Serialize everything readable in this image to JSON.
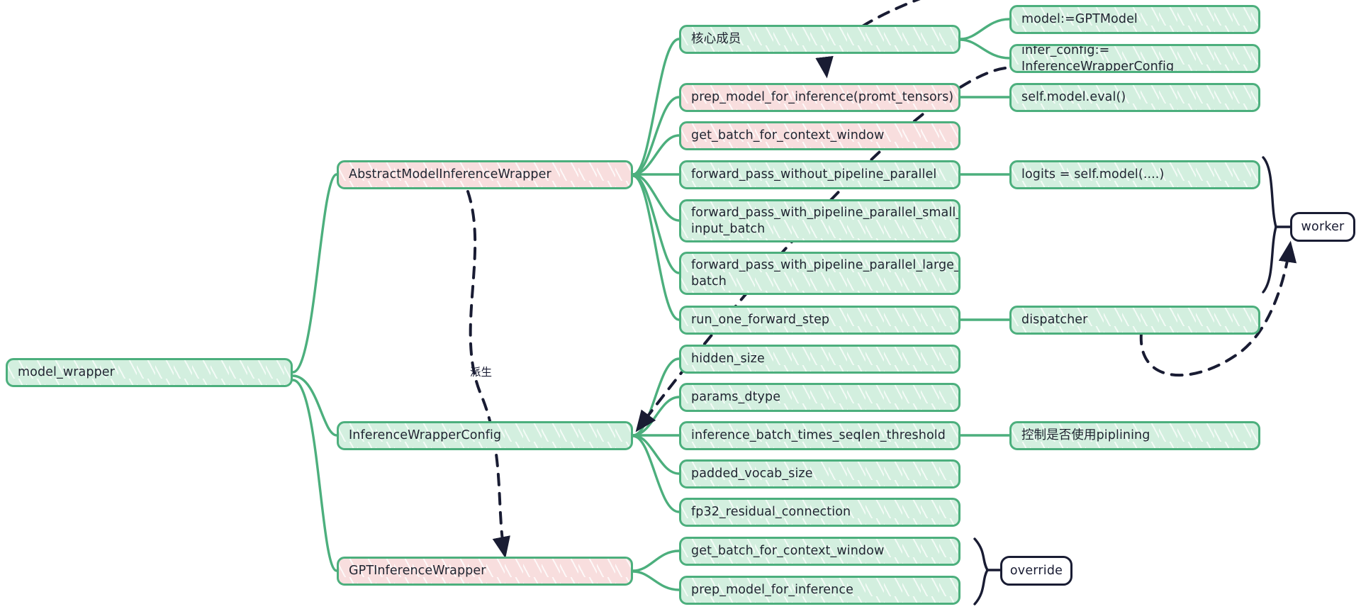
{
  "diagram": {
    "type": "mindmap",
    "title": "model_wrapper",
    "colors": {
      "node_border": "#4caf7d",
      "node_fill_green": "#d3efdf",
      "node_fill_pink": "#f8dede",
      "text": "#1f2430",
      "annotation": "#191c33"
    },
    "root": {
      "label": "model_wrapper",
      "fill": "green"
    },
    "branches": [
      {
        "label": "AbstractModelInferenceWrapper",
        "fill": "pink",
        "children": [
          {
            "label": "核心成员",
            "fill": "green",
            "children": [
              {
                "label": "model:=GPTModel",
                "fill": "green"
              },
              {
                "label": "infer_config:= InferenceWrapperConfig",
                "fill": "green"
              }
            ]
          },
          {
            "label": "prep_model_for_inference(promt_tensors)",
            "fill": "pink",
            "children": [
              {
                "label": "self.model.eval()",
                "fill": "green"
              }
            ]
          },
          {
            "label": "get_batch_for_context_window",
            "fill": "pink",
            "children": []
          },
          {
            "label": "forward_pass_without_pipeline_parallel",
            "fill": "green",
            "children": [
              {
                "label": "logits = self.model(....)",
                "fill": "green"
              }
            ]
          },
          {
            "label": "forward_pass_with_pipeline_parallel_small_\ninput_batch",
            "fill": "green",
            "children": []
          },
          {
            "label": "forward_pass_with_pipeline_parallel_large_input_\nbatch",
            "fill": "green",
            "children": []
          },
          {
            "label": "run_one_forward_step",
            "fill": "green",
            "children": [
              {
                "label": "dispatcher",
                "fill": "green"
              }
            ]
          }
        ]
      },
      {
        "label": "InferenceWrapperConfig",
        "fill": "green",
        "children": [
          {
            "label": "hidden_size",
            "fill": "green",
            "children": []
          },
          {
            "label": "params_dtype",
            "fill": "green",
            "children": []
          },
          {
            "label": "inference_batch_times_seqlen_threshold",
            "fill": "green",
            "children": [
              {
                "label": "控制是否使用piplining",
                "fill": "green"
              }
            ]
          },
          {
            "label": "padded_vocab_size",
            "fill": "green",
            "children": []
          },
          {
            "label": "fp32_residual_connection",
            "fill": "green",
            "children": []
          }
        ]
      },
      {
        "label": "GPTInferenceWrapper",
        "fill": "pink",
        "children": [
          {
            "label": "get_batch_for_context_window",
            "fill": "green",
            "children": []
          },
          {
            "label": "prep_model_for_inference",
            "fill": "green",
            "children": []
          }
        ]
      }
    ],
    "annotations": [
      {
        "label": "worker",
        "kind": "brace-tag"
      },
      {
        "label": "override",
        "kind": "brace-tag"
      },
      {
        "label": "派生",
        "kind": "edge-label"
      }
    ]
  },
  "nodes": {
    "root": "model_wrapper",
    "abstract_wrapper": "AbstractModelInferenceWrapper",
    "inference_config": "InferenceWrapperConfig",
    "gpt_wrapper": "GPTInferenceWrapper",
    "core_members": "核心成员",
    "prep_model_for_inference_args": "prep_model_for_inference(promt_tensors)",
    "get_batch_for_context_window": "get_batch_for_context_window",
    "forward_pass_without_pp": "forward_pass_without_pipeline_parallel",
    "forward_pass_with_pp_small": "forward_pass_with_pipeline_parallel_small_\ninput_batch",
    "forward_pass_with_pp_large": "forward_pass_with_pipeline_parallel_large_input_\nbatch",
    "run_one_forward_step": "run_one_forward_step",
    "hidden_size": "hidden_size",
    "params_dtype": "params_dtype",
    "inference_batch_times_seqlen_threshold": "inference_batch_times_seqlen_threshold",
    "padded_vocab_size": "padded_vocab_size",
    "fp32_residual_connection": "fp32_residual_connection",
    "gpt_get_batch": "get_batch_for_context_window",
    "gpt_prep_model": "prep_model_for_inference",
    "model_gptmodel": "model:=GPTModel",
    "infer_config_type": "infer_config:= InferenceWrapperConfig",
    "self_model_eval": "self.model.eval()",
    "logits_assign": "logits = self.model(....)",
    "dispatcher": "dispatcher",
    "piplining_note": "控制是否使用piplining"
  },
  "tags": {
    "worker": "worker",
    "override": "override",
    "derive": "派生"
  }
}
